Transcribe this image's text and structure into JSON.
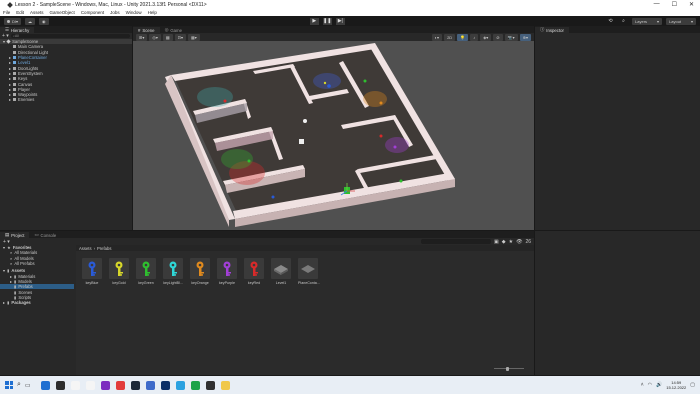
{
  "window": {
    "title": "Lesson 2 - SampleScene - Windows, Mac, Linux - Unity 2021.3.13f1 Personal <DX11>",
    "min": "—",
    "max": "☐",
    "close": "✕"
  },
  "menu": [
    "File",
    "Edit",
    "Assets",
    "GameObject",
    "Component",
    "Jobs",
    "Window",
    "Help"
  ],
  "toolbar": {
    "account": "DI",
    "layers": "Layers",
    "layout": "Layout"
  },
  "hierarchy": {
    "tab": "Hierarchy",
    "search_placeholder": "All",
    "scene": "SampleScene",
    "items": [
      {
        "label": "Main Camera",
        "color": "#c8c8c8"
      },
      {
        "label": "Directional Light",
        "color": "#c8c8c8"
      },
      {
        "label": "PlaneContainer",
        "color": "#6fa8dc"
      },
      {
        "label": "Level1",
        "color": "#6fa8dc"
      },
      {
        "label": "DoorLights",
        "color": "#c8c8c8"
      },
      {
        "label": "EventSystem",
        "color": "#c8c8c8"
      },
      {
        "label": "Keys",
        "color": "#c8c8c8"
      },
      {
        "label": "Canvas",
        "color": "#c8c8c8"
      },
      {
        "label": "Player",
        "color": "#c8c8c8"
      },
      {
        "label": "Waypoints",
        "color": "#c8c8c8"
      },
      {
        "label": "Enemies",
        "color": "#c8c8c8"
      }
    ]
  },
  "scene_view": {
    "tabs": [
      "Scene",
      "Game"
    ],
    "shading": "2D",
    "persp_label": "≡ Persp",
    "colors": {
      "floor": "#4a4541",
      "wall_top": "#f2e6e6",
      "wall_side": "#c9b4b4",
      "sky": "#555555"
    }
  },
  "inspector": {
    "tab": "Inspector"
  },
  "project": {
    "tabs": [
      "Project",
      "Console"
    ],
    "count": "26",
    "favorites_label": "Favorites",
    "favorites": [
      "All Materials",
      "All Models",
      "All Prefabs"
    ],
    "assets_label": "Assets",
    "assets": [
      "Materials",
      "Models",
      "Prefabs",
      "Scenes",
      "Scripts"
    ],
    "packages_label": "Packages",
    "breadcrumb": [
      "Assets",
      "Prefabs"
    ],
    "items": [
      {
        "name": "keyBlue",
        "color": "#2a5bd7",
        "kind": "key-icon"
      },
      {
        "name": "keyGold",
        "color": "#d7d72a",
        "kind": "key-icon"
      },
      {
        "name": "keyGreen",
        "color": "#2fbf2f",
        "kind": "key-icon"
      },
      {
        "name": "keyLightBl...",
        "color": "#2fd7d7",
        "kind": "key-icon"
      },
      {
        "name": "keyOrange",
        "color": "#e08a1e",
        "kind": "key-icon"
      },
      {
        "name": "keyPurple",
        "color": "#a23fd7",
        "kind": "key-icon"
      },
      {
        "name": "keyRed",
        "color": "#d72a2a",
        "kind": "key-icon"
      },
      {
        "name": "Level1",
        "color": "#7a7a7a",
        "kind": "level-icon"
      },
      {
        "name": "PlaneConta...",
        "color": "#6a6a6a",
        "kind": "plane-icon"
      }
    ]
  },
  "taskbar": {
    "time": "14:59",
    "date": "15.12.2022",
    "apps": [
      "#1f6fd1",
      "#2d2d2d",
      "#f5f5f5",
      "#f5f5f5",
      "#7b2cbf",
      "#e23b3b",
      "#1b2838",
      "#3e6ac9",
      "#0b2f66",
      "#2aa1e0",
      "#1ca349",
      "#303030",
      "#f0c84a"
    ]
  }
}
